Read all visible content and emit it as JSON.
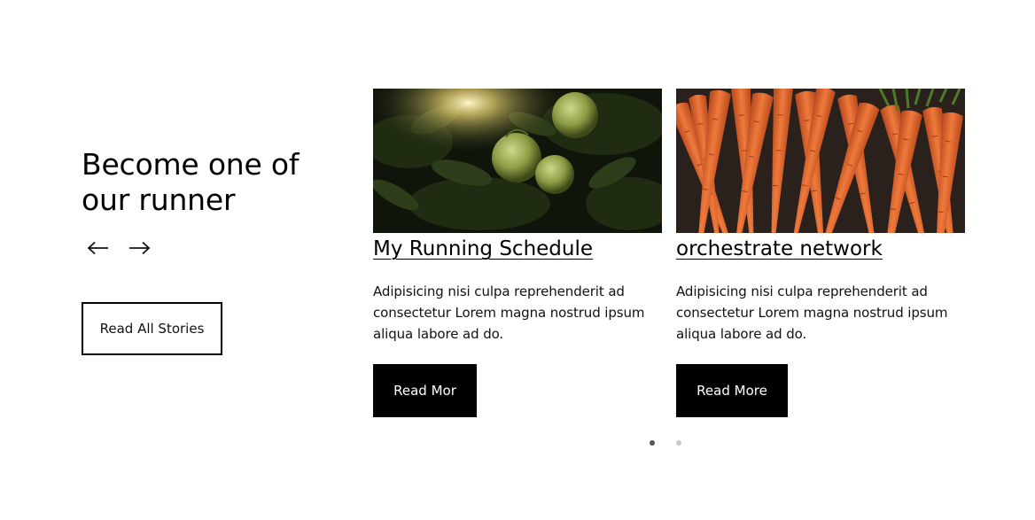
{
  "intro": {
    "heading_line1": "Become one of",
    "heading_line2": "our runner",
    "prev_icon": "arrow-left-icon",
    "next_icon": "arrow-right-icon",
    "read_all_label": "Read All Stories"
  },
  "cards": [
    {
      "image": "green-apples-on-tree",
      "title": "My Running Schedule",
      "excerpt": "Adipisicing nisi culpa reprehenderit ad consectetur Lorem magna nostrud ipsum aliqua labore ad do.",
      "button_label": "Read Mor"
    },
    {
      "image": "bunch-of-carrots",
      "title": "orchestrate network",
      "excerpt": "Adipisicing nisi culpa reprehenderit ad consectetur Lorem magna nostrud ipsum aliqua labore ad do.",
      "button_label": "Read More"
    }
  ],
  "pagination": {
    "total": 2,
    "active": 1
  },
  "colors": {
    "button_bg": "#000000",
    "button_text": "#ffffff",
    "dot_active": "#555555",
    "dot_inactive": "#c8c8c8"
  }
}
